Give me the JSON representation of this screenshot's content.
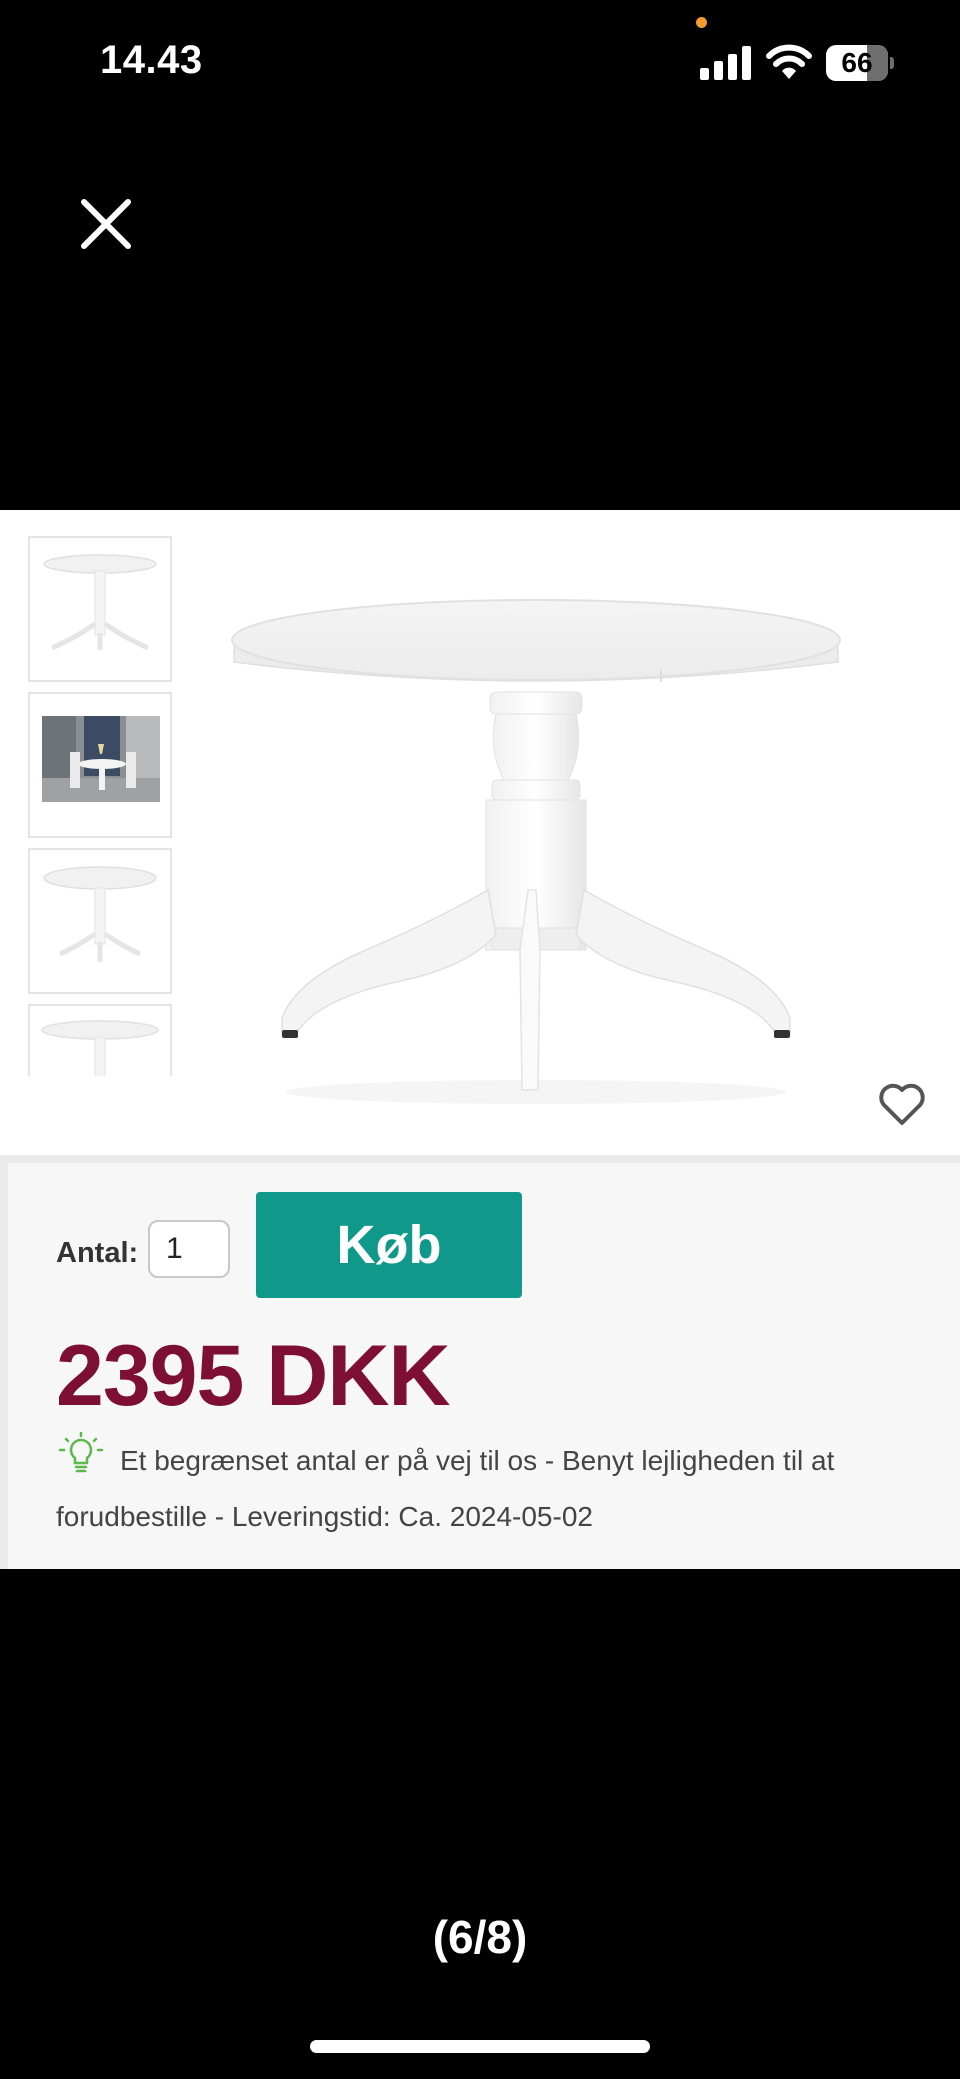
{
  "status_bar": {
    "time": "14.43",
    "battery_level": "66",
    "battery_fraction": 0.66,
    "icons": [
      "microphone-indicator-dot",
      "signal-icon",
      "wifi-icon",
      "battery-icon"
    ]
  },
  "viewer": {
    "close_icon": "close-icon",
    "counter": "(6/8)"
  },
  "product": {
    "thumbnails": [
      "round-table-thumbnail",
      "dining-room-thumbnail",
      "round-table-alt-thumbnail",
      "round-table-partial-thumbnail"
    ],
    "favorite_icon": "heart-icon",
    "quantity_label": "Antal:",
    "quantity_value": "1",
    "buy_label": "Køb",
    "price": "2395 DKK",
    "info_icon": "lightbulb-icon",
    "info_text": "Et begrænset antal er på vej til os - Benyt lejligheden til at forudbestille - Leveringstid: Ca. 2024-05-02"
  },
  "colors": {
    "buy_button": "#10998a",
    "price": "#7d0f35",
    "bulb": "#5bb84a",
    "mic_dot": "#f29a2e"
  }
}
